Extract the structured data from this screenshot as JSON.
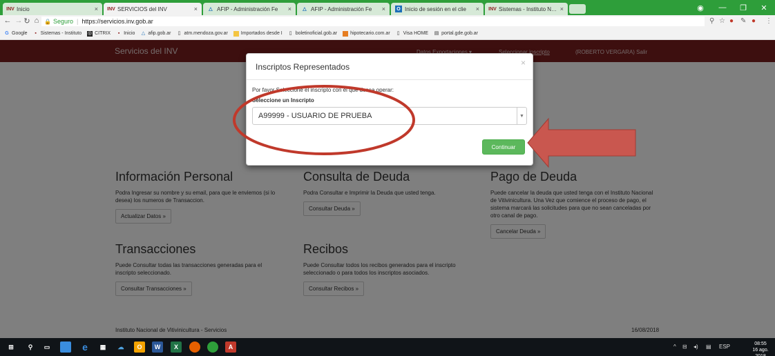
{
  "browser": {
    "tabs": [
      {
        "label": "Inicio",
        "close": "×",
        "icon": "inv-icon",
        "active": false
      },
      {
        "label": "SERVICIOS del INV",
        "close": "×",
        "icon": "inv-icon",
        "active": true
      },
      {
        "label": "AFIP - Administración Fe",
        "close": "×",
        "icon": "afip-icon",
        "active": false
      },
      {
        "label": "AFIP - Administración Fe",
        "close": "×",
        "icon": "afip-icon",
        "active": false
      },
      {
        "label": "Inicio de sesión en el clie",
        "close": "×",
        "icon": "outlook-icon",
        "active": false
      },
      {
        "label": "Sistemas - Instituto Naci",
        "close": "×",
        "icon": "inv-icon",
        "active": false
      }
    ],
    "address": {
      "secure_label": "Seguro",
      "url": "https://servicios.inv.gob.ar"
    },
    "bookmarks": [
      {
        "label": "Google",
        "icon": "google-icon"
      },
      {
        "label": "Sistemas - Instituto",
        "icon": "inv-icon"
      },
      {
        "label": "CITRIX",
        "icon": "citrix-icon"
      },
      {
        "label": "Inicio",
        "icon": "inv-icon"
      },
      {
        "label": "afip.gob.ar",
        "icon": "afip-icon"
      },
      {
        "label": "atm.mendoza.gov.ar",
        "icon": "page-icon"
      },
      {
        "label": "Importados desde I",
        "icon": "folder-icon"
      },
      {
        "label": "boletinoficial.gob.ar",
        "icon": "page-icon"
      },
      {
        "label": "hipotecario.com.ar",
        "icon": "hipotecario-icon"
      },
      {
        "label": "Visa HOME",
        "icon": "page-icon"
      },
      {
        "label": "portal.gde.gob.ar",
        "icon": "page-icon"
      }
    ]
  },
  "site": {
    "brand": "Servicios del INV",
    "nav": {
      "exportaciones": "Datos Exportaciones ▾",
      "inscripto": "Seleccionar inscripto",
      "user": "(ROBERTO VERGARA) Salir"
    },
    "sections": {
      "personal": {
        "title": "Información Personal",
        "text": "Podra Ingresar su nombre y su email, para que le enviemos (si lo desea) los numeros de Transaccion.",
        "button": "Actualizar Datos »"
      },
      "deuda": {
        "title": "Consulta de Deuda",
        "text": "Podra Consultar e Imprimir la Deuda que usted tenga.",
        "button": "Consultar Deuda »"
      },
      "pago": {
        "title": "Pago de Deuda",
        "text": "Puede cancelar la deuda que usted tenga con el Instituto Nacional de Vitivinicultura. Una Vez que comience el proceso de pago, el sistema marcará las solicitudes para que no sean canceladas por otro canal de pago.",
        "button": "Cancelar Deuda »"
      },
      "transacciones": {
        "title": "Transacciones",
        "text": "Puede Consultar todas las transacciones generadas para el inscripto seleccionado.",
        "button": "Consultar Transacciones »"
      },
      "recibos": {
        "title": "Recibos",
        "text": "Puede Consultar todos los recibos generados para el inscripto seleccionado o para todos los inscriptos asociados.",
        "button": "Consultar Recibos »"
      }
    },
    "footer": {
      "left": "Instituto Nacional de Vitivinicultura - Servicios",
      "right": "16/08/2018"
    }
  },
  "modal": {
    "title": "Inscriptos Representados",
    "close": "×",
    "text": "Por favor Seleccione el inscripto con el que desea operar:",
    "label": "Seleccione un Inscripto",
    "selected": "A99999 - USUARIO DE PRUEBA",
    "continue": "Continuar"
  },
  "annotations": {
    "highlight_color": "#c0392b",
    "arrow_color": "#c9574f"
  },
  "taskbar": {
    "language": "ESP",
    "time": "08:55",
    "date": "16 ago. 2018"
  }
}
